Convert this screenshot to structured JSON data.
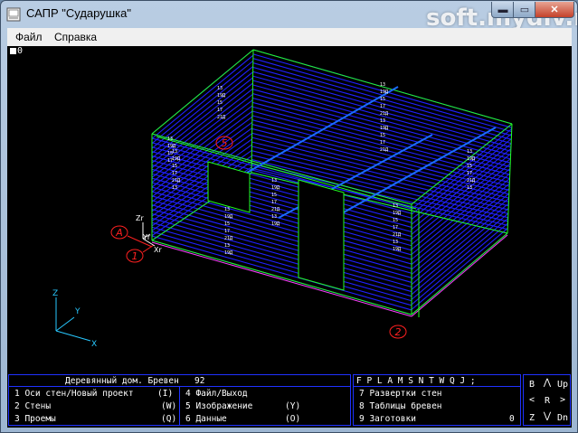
{
  "window": {
    "title": "САПР \"Сударушка\"",
    "watermark": "soft.mydiv.net",
    "minimize_glyph": "▬",
    "maximize_glyph": "▭",
    "close_glyph": "✕",
    "icon": "app-icon"
  },
  "menu": {
    "items": [
      "Файл",
      "Справка"
    ]
  },
  "viewport": {
    "indicator_label": "0",
    "markers": [
      "A",
      "1",
      "2",
      "5"
    ],
    "axis_labels": [
      "Z",
      "Y",
      "X"
    ],
    "local_axis_labels": [
      "Zr",
      "Yr",
      "Xr"
    ],
    "log_labels": [
      "13",
      "19Д",
      "15",
      "17",
      "21Д"
    ],
    "colors": {
      "background": "#000000",
      "logs": "#2020ff",
      "frame": "#20ff20",
      "axes": "#28c8ff",
      "markers": "#ff2020",
      "beams": "#1a6cff"
    }
  },
  "status": {
    "line": "Деревянный дом. Бревен   92",
    "hotkeys": "F P L A M S N T W Q J ;",
    "counter": "0"
  },
  "commands_left": [
    {
      "label": "1 Оси стен/Новый проект",
      "key": "(I)"
    },
    {
      "label": "2 Стены",
      "key": "(W)"
    },
    {
      "label": "3 Проемы",
      "key": "(Q)"
    }
  ],
  "commands_mid": [
    {
      "label": "4 Файл/Выход",
      "key": ""
    },
    {
      "label": "5 Изображение",
      "key": "(Y)"
    },
    {
      "label": "6 Данные",
      "key": "(O)"
    }
  ],
  "commands_right": [
    {
      "label": "7 Развертки стен"
    },
    {
      "label": "8 Таблицы бревен"
    },
    {
      "label": "9 Заготовки"
    }
  ],
  "nav": {
    "b": "B",
    "up_arrow": "⋀",
    "up": "Up",
    "left": "<",
    "r": "R",
    "right": ">",
    "z": "Z",
    "down_arrow": "⋁",
    "dn": "Dn"
  }
}
